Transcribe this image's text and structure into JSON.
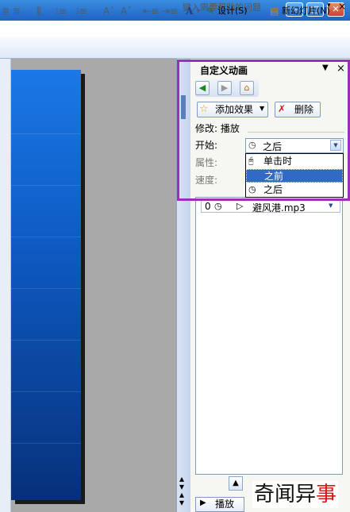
{
  "window": {
    "minimize": "—",
    "maximize": "□",
    "close": "✕"
  },
  "helpbar": {
    "search_placeholder": "键入需要帮助的问题",
    "dropdown": "▾",
    "close": "×"
  },
  "toolbar": {
    "font_size_up": "Aˆ",
    "font_size_down": "Aˇ",
    "font_color": "A",
    "design_label": "设计(S)",
    "new_slide_label": "新幻灯片(N)"
  },
  "task_pane": {
    "title": "自定义动画",
    "dropdown": "▼",
    "close": "×",
    "nav_back": "◀",
    "nav_forward": "▶",
    "nav_home": "⌂",
    "add_effect_label": "添加效果",
    "delete_label": "删除",
    "modify_label": "修改: 播放",
    "start_label": "开始:",
    "start_value": "之后",
    "property_label": "属性:",
    "speed_label": "速度:",
    "start_options": [
      {
        "label": "单击时"
      },
      {
        "label": "之前"
      },
      {
        "label": "之后"
      }
    ],
    "selected_option": "之前",
    "effects": [
      {
        "order": "0",
        "name": "避风港.mp3"
      }
    ],
    "play_label": "播放"
  },
  "watermark": {
    "prefix": "奇闻异",
    "suffix": "事"
  },
  "colors": {
    "highlight": "#9e2eb8",
    "selection": "#316ac5",
    "slide": "#0e5bc4"
  }
}
